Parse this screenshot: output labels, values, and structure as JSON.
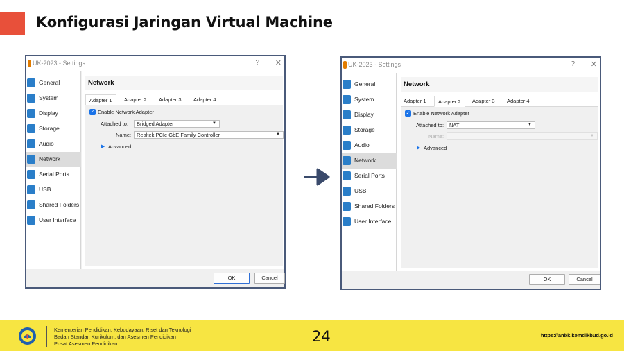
{
  "slide": {
    "title": "Konfigurasi Jaringan Virtual Machine",
    "accent_color": "#e8503a"
  },
  "dialogs": [
    {
      "window_title": "UK-2023 - Settings",
      "help": "?",
      "close": "✕",
      "sidebar": [
        {
          "label": "General",
          "icon": "general-icon"
        },
        {
          "label": "System",
          "icon": "system-icon"
        },
        {
          "label": "Display",
          "icon": "display-icon"
        },
        {
          "label": "Storage",
          "icon": "storage-icon"
        },
        {
          "label": "Audio",
          "icon": "audio-icon"
        },
        {
          "label": "Network",
          "icon": "network-icon",
          "active": true
        },
        {
          "label": "Serial Ports",
          "icon": "serial-ports-icon"
        },
        {
          "label": "USB",
          "icon": "usb-icon"
        },
        {
          "label": "Shared Folders",
          "icon": "shared-folders-icon"
        },
        {
          "label": "User Interface",
          "icon": "user-interface-icon"
        }
      ],
      "panel_title": "Network",
      "tabs": [
        "Adapter 1",
        "Adapter 2",
        "Adapter 3",
        "Adapter 4"
      ],
      "selected_tab": "Adapter 1",
      "enable_label": "Enable Network Adapter",
      "enable_checked": true,
      "attached_label": "Attached to:",
      "attached_value": "Bridged Adapter",
      "name_label": "Name:",
      "name_value": "Realtek PCIe GbE Family Controller",
      "advanced_label": "Advanced",
      "ok_label": "OK",
      "cancel_label": "Cancel"
    },
    {
      "window_title": "UK-2023 - Settings",
      "help": "?",
      "close": "✕",
      "sidebar": [
        {
          "label": "General",
          "icon": "general-icon"
        },
        {
          "label": "System",
          "icon": "system-icon"
        },
        {
          "label": "Display",
          "icon": "display-icon"
        },
        {
          "label": "Storage",
          "icon": "storage-icon"
        },
        {
          "label": "Audio",
          "icon": "audio-icon"
        },
        {
          "label": "Network",
          "icon": "network-icon",
          "active": true
        },
        {
          "label": "Serial Ports",
          "icon": "serial-ports-icon"
        },
        {
          "label": "USB",
          "icon": "usb-icon"
        },
        {
          "label": "Shared Folders",
          "icon": "shared-folders-icon"
        },
        {
          "label": "User Interface",
          "icon": "user-interface-icon"
        }
      ],
      "panel_title": "Network",
      "tabs": [
        "Adapter 1",
        "Adapter 2",
        "Adapter 3",
        "Adapter 4"
      ],
      "selected_tab": "Adapter 2",
      "enable_label": "Enable Network Adapter",
      "enable_checked": true,
      "attached_label": "Attached to:",
      "attached_value": "NAT",
      "name_label": "Name:",
      "name_value": "",
      "advanced_label": "Advanced",
      "ok_label": "OK",
      "cancel_label": "Cancel"
    }
  ],
  "arrow_color": "#3a4a6b",
  "footer": {
    "bg_color": "#f7e542",
    "institution_lines": [
      "Kementerian Pendidikan, Kebudayaan, Riset dan Teknologi",
      "Badan Standar, Kurikulum, dan Asesmen Pendidikan",
      "Pusat Asesmen Pendidikan"
    ],
    "page_number": "24",
    "url": "https://anbk.kemdikbud.go.id"
  }
}
